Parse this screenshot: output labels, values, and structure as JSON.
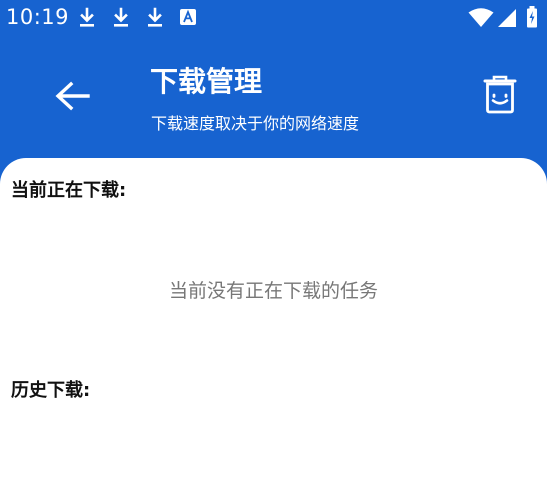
{
  "status_bar": {
    "time": "10:19",
    "notification_icons": [
      "download-icon",
      "download-icon",
      "download-icon",
      "a-icon"
    ],
    "system_icons": [
      "wifi-icon",
      "cell-signal-icon",
      "battery-icon"
    ]
  },
  "app_bar": {
    "title": "下载管理",
    "subtitle": "下载速度取决于你的网络速度",
    "back_icon": "arrow-left-icon",
    "delete_icon": "trash-icon"
  },
  "content": {
    "current_heading": "当前正在下载:",
    "current_empty": "当前没有正在下载的任务",
    "history_heading": "历史下载:"
  },
  "colors": {
    "header_bg": "#1763d0",
    "text_primary": "#111111",
    "text_secondary": "#777777"
  }
}
